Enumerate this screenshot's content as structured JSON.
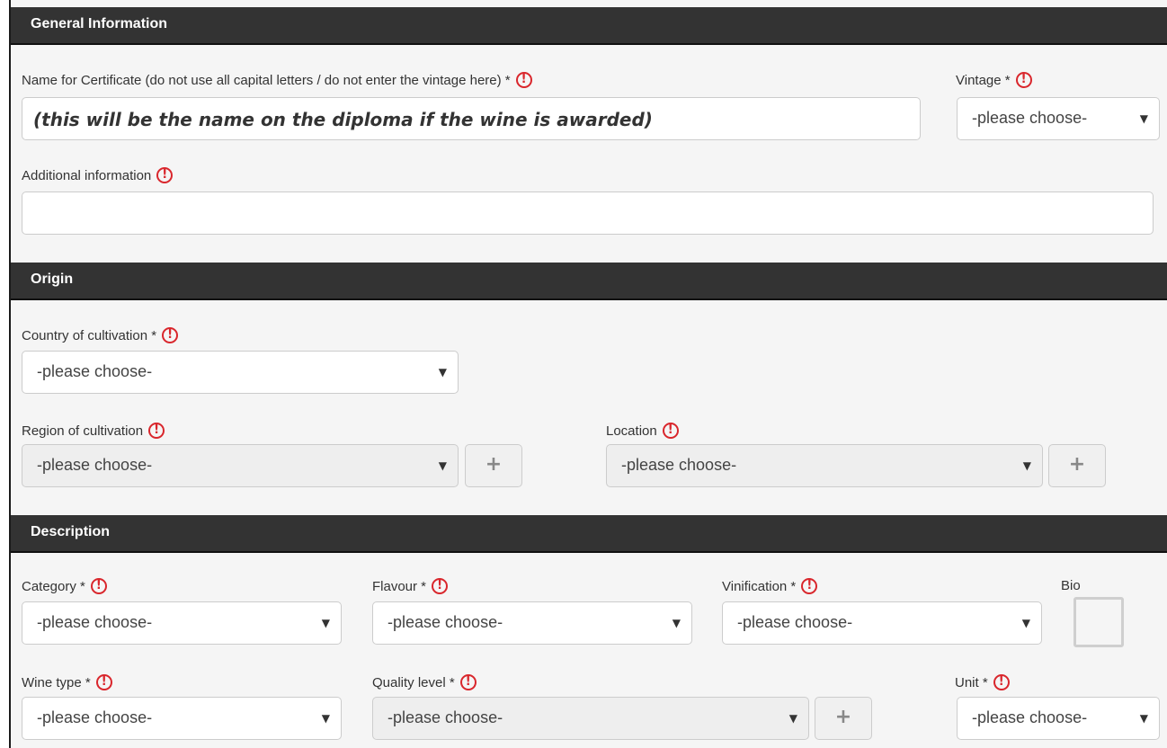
{
  "general": {
    "header": "General Information",
    "name_label": "Name for Certificate (do not use all capital letters / do not enter the vintage here) *",
    "name_value": "(this will be the name on the diploma if the wine is awarded)",
    "vintage_label": "Vintage *",
    "vintage_value": "-please choose-",
    "additional_label": "Additional information",
    "additional_value": ""
  },
  "origin": {
    "header": "Origin",
    "country_label": "Country of cultivation *",
    "country_value": "-please choose-",
    "region_label": "Region of cultivation",
    "region_value": "-please choose-",
    "location_label": "Location",
    "location_value": "-please choose-"
  },
  "description": {
    "header": "Description",
    "category_label": "Category *",
    "category_value": "-please choose-",
    "flavour_label": "Flavour *",
    "flavour_value": "-please choose-",
    "vinification_label": "Vinification *",
    "vinification_value": "-please choose-",
    "bio_label": "Bio",
    "bio_checked": false,
    "winetype_label": "Wine type *",
    "winetype_value": "-please choose-",
    "quality_label": "Quality level *",
    "quality_value": "-please choose-",
    "unit_label": "Unit *",
    "unit_value": "-please choose-"
  },
  "icons": {
    "warning": "!",
    "caret": "▼",
    "plus": "+"
  },
  "colors": {
    "header_bg": "#333333",
    "warning": "#d9262c",
    "panel_bg": "#f5f5f5"
  }
}
